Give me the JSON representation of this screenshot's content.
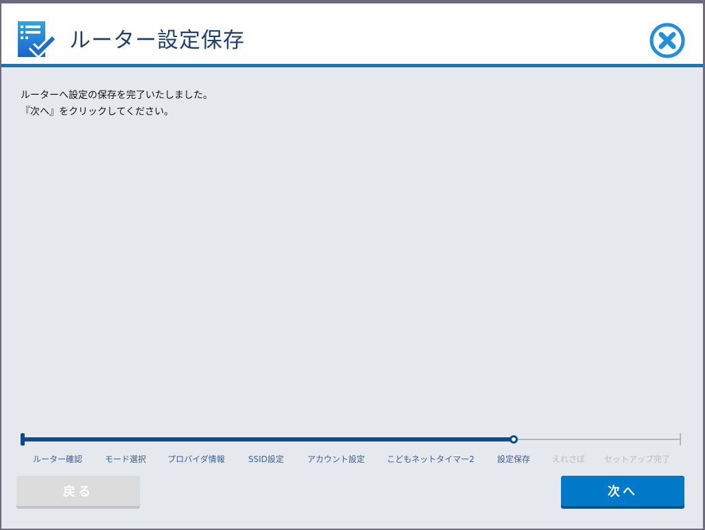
{
  "header": {
    "title": "ルーター設定保存"
  },
  "message": {
    "line1": "ルーターへ設定の保存を完了いたしました。",
    "line2": "『次へ』をクリックしてください。"
  },
  "progress": {
    "current_index": 6,
    "fraction": 0.746,
    "steps": [
      "ルーター確認",
      "モード選択",
      "プロバイダ情報",
      "SSID設定",
      "アカウント設定",
      "こどもネットタイマー2",
      "設定保存",
      "えれさぼ",
      "セットアップ完了"
    ]
  },
  "buttons": {
    "back": "戻る",
    "next": "次へ"
  },
  "colors": {
    "accent": "#0079c8",
    "progress": "#0b4a8c",
    "title": "#1f3f73"
  }
}
